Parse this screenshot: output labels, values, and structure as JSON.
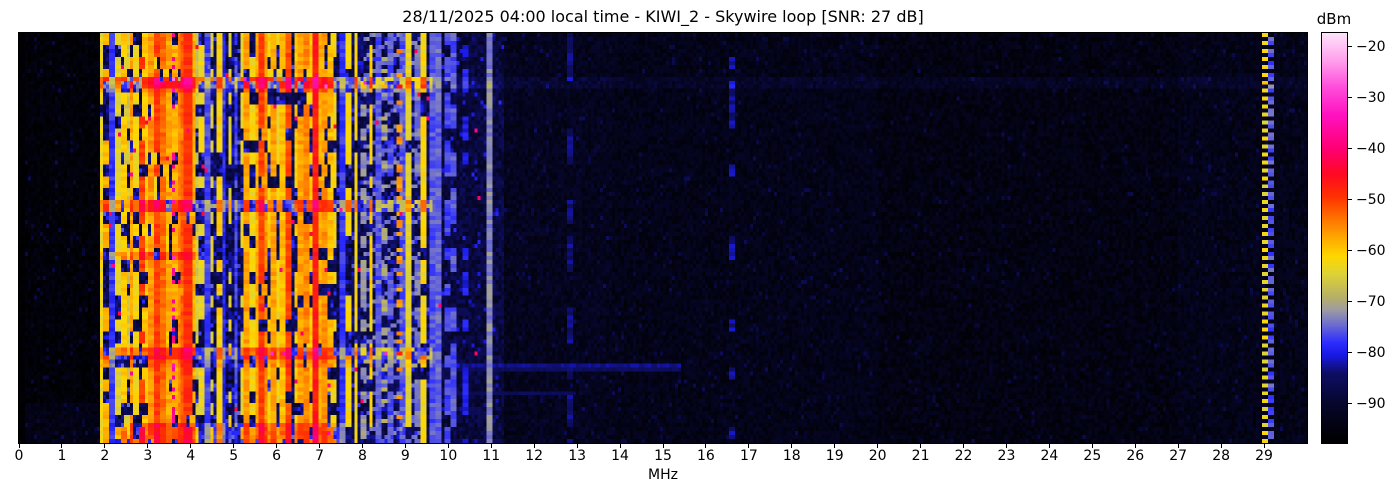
{
  "title": "28/11/2025 04:00 local time - KIWI_2 - Skywire loop [SNR: 27 dB]",
  "header": {
    "date": "28/11/2025",
    "time": "04:00 local time",
    "station": "KIWI_2",
    "antenna": "Skywire loop",
    "snr": "27 dB"
  },
  "chart_data": {
    "type": "heatmap",
    "subtype": "hf-spectrum-waterfall",
    "title": "28/11/2025 04:00 local time - KIWI_2 - Skywire loop [SNR: 27 dB]",
    "xlabel": "MHz",
    "x_range_mhz": [
      0,
      30
    ],
    "x_ticks": [
      "0",
      "1",
      "2",
      "3",
      "4",
      "5",
      "6",
      "7",
      "8",
      "9",
      "10",
      "11",
      "12",
      "13",
      "14",
      "15",
      "16",
      "17",
      "18",
      "19",
      "20",
      "21",
      "22",
      "23",
      "24",
      "25",
      "26",
      "27",
      "28",
      "29"
    ],
    "grid": false,
    "colorbar": {
      "label": "dBm",
      "tick_labels": [
        "−20",
        "−30",
        "−40",
        "−50",
        "−60",
        "−70",
        "−80",
        "−90"
      ],
      "tick_values": [
        -20,
        -30,
        -40,
        -50,
        -60,
        -70,
        -80,
        -90
      ],
      "top_value": -17.3,
      "bottom_value": -97.7,
      "stops": [
        [
          0.0,
          "#000000"
        ],
        [
          0.09,
          "#06062a"
        ],
        [
          0.17,
          "#0e0e66"
        ],
        [
          0.215,
          "#1a1ae8"
        ],
        [
          0.245,
          "#2e2eff"
        ],
        [
          0.29,
          "#7070cf"
        ],
        [
          0.325,
          "#9e9da2"
        ],
        [
          0.355,
          "#b7b068"
        ],
        [
          0.41,
          "#ddd23a"
        ],
        [
          0.455,
          "#ffd800"
        ],
        [
          0.5,
          "#ffaa00"
        ],
        [
          0.55,
          "#ff7000"
        ],
        [
          0.6,
          "#ff3300"
        ],
        [
          0.655,
          "#ff0a22"
        ],
        [
          0.715,
          "#ff0070"
        ],
        [
          0.8,
          "#ff12c0"
        ],
        [
          0.87,
          "#ff4fdc"
        ],
        [
          0.93,
          "#ff9cec"
        ],
        [
          1.0,
          "#ffe3fb"
        ]
      ]
    },
    "noise_regions_format": "[f0_mhz, f1_mhz, base_dbm, variance_db, speckle_prob, speckle_boost_db, pink_speckle_prob]",
    "noise_regions": [
      [
        0.0,
        0.12,
        -97.0,
        0.6,
        0.01,
        4,
        0
      ],
      [
        0.12,
        1.85,
        -96.0,
        1.8,
        0.05,
        7,
        0
      ],
      [
        1.85,
        9.55,
        -86.5,
        4.5,
        0.18,
        7,
        0.004
      ],
      [
        9.55,
        11.3,
        -88.5,
        3.5,
        0.1,
        6,
        0.001
      ],
      [
        11.3,
        13.8,
        -92.5,
        2.6,
        0.06,
        5,
        0
      ],
      [
        20.0,
        27.0,
        -94.5,
        2.4,
        0.05,
        5,
        0
      ],
      [
        13.8,
        30.0,
        -93.5,
        2.4,
        0.06,
        5,
        0
      ]
    ],
    "signals_format": "[freq_mhz, halfwidth_mhz, level_dbm, style(solid|seg|dots|dot2|dash3), density]",
    "signals": [
      [
        1.92,
        0.03,
        -63,
        "seg",
        0.92
      ],
      [
        2.05,
        0.03,
        -58,
        "seg",
        0.5
      ],
      [
        2.17,
        0.03,
        -78,
        "solid",
        1
      ],
      [
        2.3,
        0.03,
        -64,
        "seg",
        0.7
      ],
      [
        2.42,
        0.03,
        -60,
        "seg",
        0.8
      ],
      [
        2.52,
        0.03,
        -66,
        "seg",
        0.6
      ],
      [
        2.62,
        0.03,
        -57,
        "seg",
        0.85
      ],
      [
        2.72,
        0.03,
        -62,
        "seg",
        0.7
      ],
      [
        2.85,
        0.03,
        -50,
        "seg",
        0.55
      ],
      [
        2.95,
        0.03,
        -60,
        "seg",
        0.8
      ],
      [
        3.05,
        0.03,
        -56,
        "seg",
        0.9
      ],
      [
        3.15,
        0.03,
        -62,
        "seg",
        0.7
      ],
      [
        3.22,
        0.03,
        -50,
        "seg",
        0.75
      ],
      [
        3.32,
        0.03,
        -53,
        "seg",
        0.9
      ],
      [
        3.4,
        0.03,
        -60,
        "seg",
        0.8
      ],
      [
        3.5,
        0.03,
        -57,
        "seg",
        0.7
      ],
      [
        3.58,
        0.02,
        -38,
        "dots",
        0.22
      ],
      [
        3.65,
        0.03,
        -58,
        "seg",
        0.85
      ],
      [
        3.75,
        0.03,
        -55,
        "seg",
        0.9
      ],
      [
        3.85,
        0.03,
        -52,
        "seg",
        0.9
      ],
      [
        3.95,
        0.05,
        -49,
        "seg",
        0.95
      ],
      [
        4.05,
        0.03,
        -58,
        "seg",
        0.8
      ],
      [
        4.15,
        0.03,
        -66,
        "seg",
        0.6
      ],
      [
        4.28,
        0.03,
        -63,
        "seg",
        0.5
      ],
      [
        4.4,
        0.03,
        -77,
        "solid",
        1
      ],
      [
        4.5,
        0.03,
        -65,
        "seg",
        0.5
      ],
      [
        4.65,
        0.03,
        -61,
        "seg",
        0.92
      ],
      [
        4.78,
        0.03,
        -79,
        "solid",
        1
      ],
      [
        4.92,
        0.03,
        -64,
        "seg",
        0.4
      ],
      [
        5.06,
        0.03,
        -77,
        "seg",
        0.7
      ],
      [
        5.2,
        0.03,
        -63,
        "seg",
        0.5
      ],
      [
        5.32,
        0.03,
        -57,
        "seg",
        0.75
      ],
      [
        5.45,
        0.03,
        -62,
        "seg",
        0.6
      ],
      [
        5.55,
        0.03,
        -58,
        "seg",
        0.85
      ],
      [
        5.64,
        0.04,
        -50,
        "seg",
        0.9
      ],
      [
        5.75,
        0.03,
        -56,
        "seg",
        0.85
      ],
      [
        5.85,
        0.03,
        -61,
        "seg",
        0.7
      ],
      [
        5.95,
        0.03,
        -57,
        "seg",
        0.8
      ],
      [
        6.05,
        0.03,
        -63,
        "seg",
        0.7
      ],
      [
        6.15,
        0.03,
        -59,
        "seg",
        0.8
      ],
      [
        6.3,
        0.03,
        -51,
        "seg",
        0.8
      ],
      [
        6.45,
        0.03,
        -60,
        "seg",
        0.7
      ],
      [
        6.55,
        0.03,
        -57,
        "seg",
        0.85
      ],
      [
        6.67,
        0.03,
        -55,
        "seg",
        0.85
      ],
      [
        6.78,
        0.03,
        -60,
        "seg",
        0.7
      ],
      [
        6.9,
        0.05,
        -47,
        "solid",
        1
      ],
      [
        7.02,
        0.03,
        -58,
        "seg",
        0.8
      ],
      [
        7.12,
        0.03,
        -56,
        "seg",
        0.8
      ],
      [
        7.25,
        0.03,
        -59,
        "seg",
        0.75
      ],
      [
        7.35,
        0.03,
        -62,
        "seg",
        0.6
      ],
      [
        7.55,
        0.03,
        -78,
        "solid",
        1
      ],
      [
        7.7,
        0.03,
        -62,
        "seg",
        0.5
      ],
      [
        7.85,
        0.03,
        -62,
        "seg",
        0.9
      ],
      [
        8.0,
        0.03,
        -72,
        "seg",
        0.5
      ],
      [
        8.2,
        0.03,
        -61,
        "seg",
        0.75
      ],
      [
        8.35,
        0.03,
        -76,
        "solid",
        1
      ],
      [
        8.5,
        0.02,
        -70,
        "dots",
        0.3
      ],
      [
        8.65,
        0.03,
        -76,
        "seg",
        0.7
      ],
      [
        8.86,
        0.02,
        -56,
        "dots",
        0.35
      ],
      [
        8.95,
        0.03,
        -76,
        "solid",
        1
      ],
      [
        9.05,
        0.03,
        -64,
        "seg",
        0.9
      ],
      [
        9.28,
        0.03,
        -74,
        "seg",
        0.5
      ],
      [
        9.42,
        0.03,
        -62,
        "seg",
        0.85
      ],
      [
        9.6,
        0.03,
        -76,
        "solid",
        1
      ],
      [
        9.78,
        0.03,
        -75,
        "solid",
        1
      ],
      [
        9.95,
        0.03,
        -77,
        "seg",
        0.7
      ],
      [
        10.12,
        0.03,
        -76,
        "seg",
        0.6
      ],
      [
        10.4,
        0.03,
        -80,
        "seg",
        0.5
      ],
      [
        10.95,
        0.04,
        -73,
        "solid",
        1
      ],
      [
        12.85,
        0.03,
        -84,
        "seg",
        0.5
      ],
      [
        16.6,
        0.03,
        -83,
        "seg",
        0.4
      ],
      [
        29.0,
        0.03,
        -63,
        "dot2",
        1
      ],
      [
        29.17,
        0.03,
        -76,
        "dash3",
        1
      ]
    ],
    "hatch_region": {
      "f0": 8.05,
      "f1": 9.35,
      "level_dbm": -76
    },
    "time_bands_format": "[row0, row1, f0_mhz, f1_mhz, boost_db] (103 time rows total)",
    "time_bands": [
      [
        11,
        13,
        1.85,
        9.6,
        11
      ],
      [
        14,
        14,
        1.85,
        9.6,
        4
      ],
      [
        11,
        13,
        9.6,
        30,
        2.5
      ],
      [
        42,
        44,
        1.85,
        9.6,
        8
      ],
      [
        55,
        56,
        1.9,
        4.3,
        6
      ],
      [
        79,
        81,
        1.85,
        9.6,
        8
      ],
      [
        82,
        83,
        1.85,
        9.6,
        3
      ],
      [
        98,
        102,
        2.2,
        7.6,
        6
      ],
      [
        93,
        102,
        0.12,
        1.85,
        2
      ]
    ],
    "horizontal_lines_format": "[row, f0_mhz, f1_mhz, level_dbm]",
    "horizontal_lines": [
      [
        83,
        9.6,
        15.4,
        -84
      ],
      [
        84,
        9.6,
        15.4,
        -86
      ],
      [
        90,
        9.6,
        13.0,
        -86.5
      ]
    ]
  }
}
